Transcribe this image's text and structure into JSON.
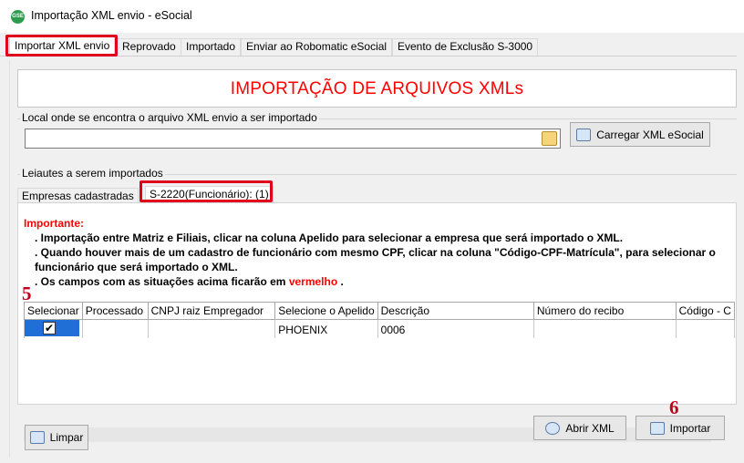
{
  "window": {
    "title": "Importação  XML envio - eSocial",
    "app_icon_text": "GSE"
  },
  "tabs": [
    {
      "label": "Importar XML envio",
      "active": true
    },
    {
      "label": "Reprovado"
    },
    {
      "label": "Importado"
    },
    {
      "label": "Enviar ao Robomatic eSocial"
    },
    {
      "label": "Evento de Exclusão S-3000"
    }
  ],
  "header": {
    "title": "IMPORTAÇÃO DE ARQUIVOS XMLs"
  },
  "location_group": {
    "label": "Local onde se encontra o arquivo XML envio a ser importado",
    "path_value": "",
    "load_button": "Carregar XML eSocial"
  },
  "layouts_group": {
    "label": "Leiautes a serem importados"
  },
  "subtabs": [
    {
      "label": "Empresas cadastradas"
    },
    {
      "label": "S-2220(Funcionário): (1)",
      "active": true
    }
  ],
  "notes": {
    "heading": "Importante:",
    "line1": ". Importação entre Matriz e Filiais, clicar na coluna Apelido para selecionar a empresa que será importado o XML.",
    "line2": ". Quando houver mais de um cadastro de funcionário com mesmo CPF, clicar na coluna \"Código-CPF-Matrícula\", para selecionar o",
    "line3": "funcionário que será importado o XML.",
    "line4_prefix": ". Os campos com as situações acima ficarão em",
    "line4_red": "vermelho",
    "line4_suffix": "."
  },
  "markers": {
    "left": "5",
    "right": "6"
  },
  "table": {
    "columns": [
      "Selecionar",
      "Processado",
      "CNPJ raiz Empregador",
      "Selecione o Apelido",
      "Descrição",
      "Número do recibo",
      "Código - C"
    ],
    "rows": [
      {
        "selected": true,
        "check_glyph": "✔",
        "processado": "",
        "cnpj": "",
        "apelido": "PHOENIX",
        "descricao": "0006",
        "recibo": "",
        "codigo": ""
      }
    ]
  },
  "scrollbar": {
    "left_arrow": "‹"
  },
  "buttons": {
    "clear": "Limpar",
    "open_xml": "Abrir XML",
    "import": "Importar"
  },
  "colors": {
    "accent_red": "#ff0000",
    "highlight_box": "#e0001b",
    "selection_blue": "#1f6fd6"
  }
}
